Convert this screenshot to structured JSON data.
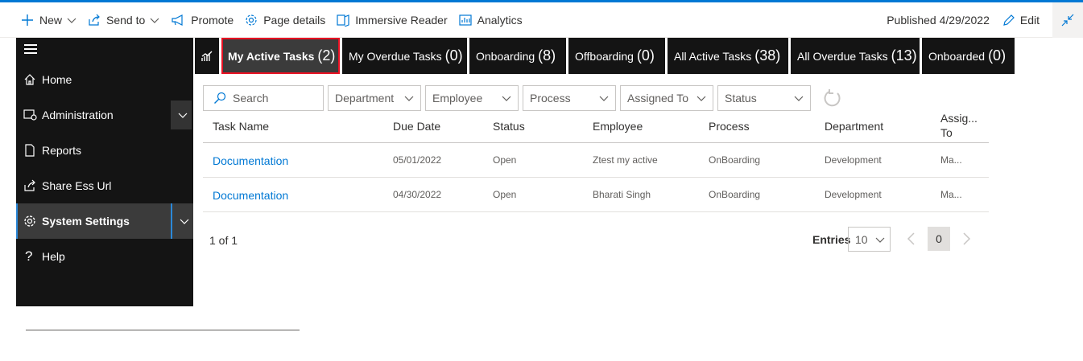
{
  "command_bar": {
    "new_label": "New",
    "send_to_label": "Send to",
    "promote_label": "Promote",
    "page_details_label": "Page details",
    "immersive_reader_label": "Immersive Reader",
    "analytics_label": "Analytics",
    "published_text": "Published 4/29/2022",
    "edit_label": "Edit"
  },
  "sidebar": {
    "items": [
      {
        "label": "Home",
        "icon": "home-icon"
      },
      {
        "label": "Administration",
        "icon": "admin-icon",
        "expandable": true
      },
      {
        "label": "Reports",
        "icon": "document-icon"
      },
      {
        "label": "Share Ess Url",
        "icon": "share-icon"
      },
      {
        "label": "System Settings",
        "icon": "gear-icon",
        "expandable": true,
        "selected": true
      },
      {
        "label": "Help",
        "icon": "question-icon"
      }
    ]
  },
  "tabs": [
    {
      "label": "My Active Tasks",
      "count": "(2)",
      "active": true
    },
    {
      "label": "My Overdue Tasks",
      "count": "(0)"
    },
    {
      "label": "Onboarding",
      "count": "(8)"
    },
    {
      "label": "Offboarding",
      "count": "(0)"
    },
    {
      "label": "All Active Tasks",
      "count": "(38)"
    },
    {
      "label": "All Overdue Tasks",
      "count": "(13)"
    },
    {
      "label": "Onboarded",
      "count": "(0)"
    }
  ],
  "filters": {
    "search_placeholder": "Search",
    "dropdowns": [
      "Department",
      "Employee",
      "Process",
      "Assigned To",
      "Status"
    ]
  },
  "table": {
    "columns": [
      "Task Name",
      "Due Date",
      "Status",
      "Employee",
      "Process",
      "Department",
      "Assig... To"
    ],
    "rows": [
      {
        "task": "Documentation",
        "due": "05/01/2022",
        "status": "Open",
        "employee": "Ztest my active",
        "process": "OnBoarding",
        "department": "Development",
        "assigned": "Ma..."
      },
      {
        "task": "Documentation",
        "due": "04/30/2022",
        "status": "Open",
        "employee": "Bharati Singh",
        "process": "OnBoarding",
        "department": "Development",
        "assigned": "Ma..."
      }
    ]
  },
  "footer": {
    "page_info": "1 of 1",
    "entries_label": "Entries",
    "entries_value": "10",
    "current_page": "0"
  },
  "colors": {
    "accent": "#0078d4",
    "sidebar_bg": "#141414",
    "active_tab_border": "#e81123"
  }
}
